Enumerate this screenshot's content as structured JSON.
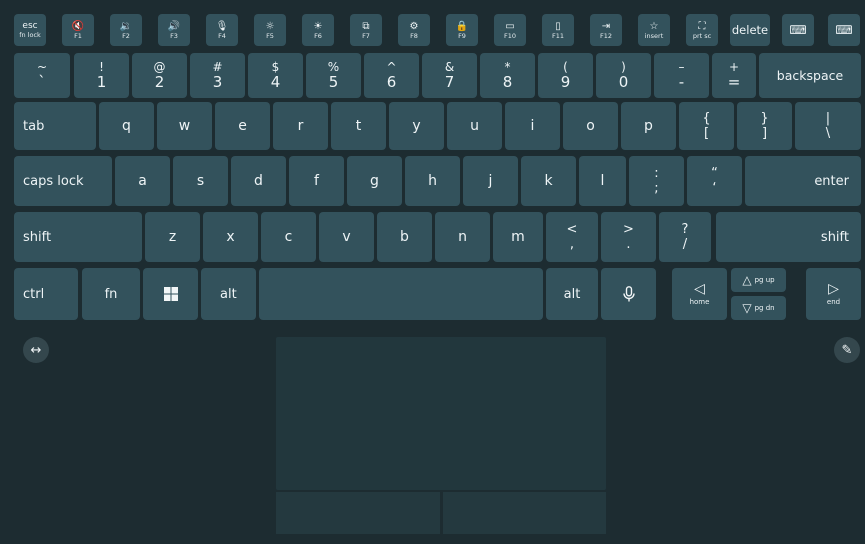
{
  "fn_row": {
    "esc_top": "esc",
    "esc_sub": "fn lock",
    "keys": [
      {
        "icon": "🔇",
        "label": "F1"
      },
      {
        "icon": "🔉",
        "label": "F2"
      },
      {
        "icon": "🔊",
        "label": "F3"
      },
      {
        "icon": "🎙",
        "label": "F4"
      },
      {
        "icon": "☼",
        "label": "F5"
      },
      {
        "icon": "☀",
        "label": "F6"
      },
      {
        "icon": "⧉",
        "label": "F7"
      },
      {
        "icon": "⚙",
        "label": "F8"
      },
      {
        "icon": "🔒",
        "label": "F9"
      },
      {
        "icon": "▭",
        "label": "F10"
      },
      {
        "icon": "▯",
        "label": "F11"
      },
      {
        "icon": "⇥",
        "label": "F12"
      },
      {
        "icon": "☆",
        "label": "insert"
      },
      {
        "icon": "⛶",
        "label": "prt sc"
      }
    ],
    "delete": "delete",
    "settings_icon": "⌨",
    "keyboard_icon": "⌨"
  },
  "num_row": {
    "keys": [
      {
        "up": "~",
        "dn": "`"
      },
      {
        "up": "!",
        "dn": "1"
      },
      {
        "up": "@",
        "dn": "2"
      },
      {
        "up": "#",
        "dn": "3"
      },
      {
        "up": "$",
        "dn": "4"
      },
      {
        "up": "%",
        "dn": "5"
      },
      {
        "up": "^",
        "dn": "6"
      },
      {
        "up": "&",
        "dn": "7"
      },
      {
        "up": "*",
        "dn": "8"
      },
      {
        "up": "(",
        "dn": "9"
      },
      {
        "up": ")",
        "dn": "0"
      },
      {
        "up": "–",
        "dn": "-"
      },
      {
        "up": "+",
        "dn": "="
      }
    ],
    "backspace": "backspace"
  },
  "top_row": {
    "tab": "tab",
    "letters": [
      "q",
      "w",
      "e",
      "r",
      "t",
      "y",
      "u",
      "i",
      "o",
      "p"
    ],
    "sym": [
      {
        "up": "{",
        "dn": "["
      },
      {
        "up": "}",
        "dn": "]"
      },
      {
        "up": "|",
        "dn": "\\"
      }
    ]
  },
  "home_row": {
    "caps": "caps lock",
    "letters": [
      "a",
      "s",
      "d",
      "f",
      "g",
      "h",
      "j",
      "k",
      "l"
    ],
    "sym": [
      {
        "up": ":",
        "dn": ";"
      },
      {
        "up": "“",
        "dn": "‘"
      }
    ],
    "enter": "enter"
  },
  "bottom_row": {
    "shift_left": "shift",
    "letters": [
      "z",
      "x",
      "c",
      "v",
      "b",
      "n",
      "m"
    ],
    "sym": [
      {
        "up": "<",
        "dn": ","
      },
      {
        "up": ">",
        "dn": "."
      },
      {
        "up": "?",
        "dn": "/"
      }
    ],
    "shift_right": "shift"
  },
  "space_row": {
    "ctrl": "ctrl",
    "fn": "fn",
    "alt_left": "alt",
    "alt_right": "alt",
    "home_arrow": "◁",
    "home_label": "home",
    "pgup_arrow": "△",
    "pgup_label": "pg up",
    "pgdn_arrow": "▽",
    "pgdn_label": "pg dn",
    "end_arrow": "▷",
    "end_label": "end"
  },
  "controls": {
    "resize_icon": "↔",
    "pen_icon": "✎"
  }
}
